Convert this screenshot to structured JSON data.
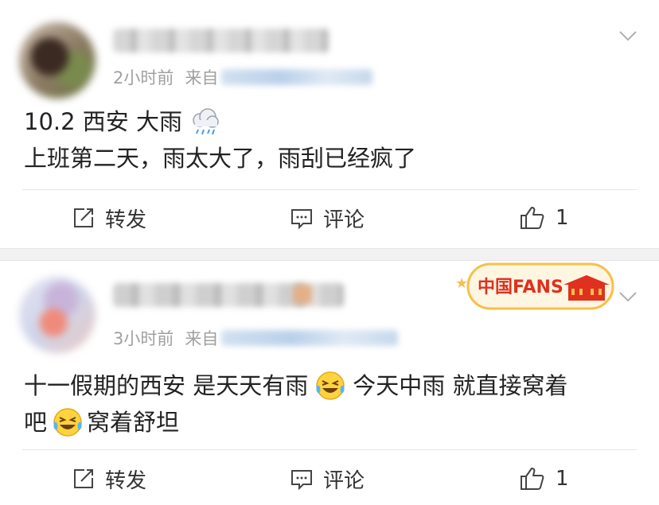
{
  "posts": [
    {
      "time": "2小时前",
      "from_label": "来自",
      "lines": [
        "10.2 西安 大雨",
        "上班第二天，雨太大了，雨刮已经疯了"
      ],
      "emoji": [
        "rain-cloud-icon"
      ],
      "actions": {
        "repost": "转发",
        "comment": "评论",
        "like_count": "1"
      }
    },
    {
      "time": "3小时前",
      "from_label": "来自",
      "lines": [
        "十一假期的西安 是天天有雨",
        "今天中雨  就直接窝着",
        "吧",
        "窝着舒坦"
      ],
      "emoji": [
        "laughing-tears-icon",
        "laughing-tears-icon"
      ],
      "badge_text": "中国FANS",
      "actions": {
        "repost": "转发",
        "comment": "评论",
        "like_count": "1"
      }
    }
  ],
  "colors": {
    "meta": "#a0a0a0",
    "text": "#222222",
    "badge_red": "#e0301e",
    "badge_gold": "#f6c04a",
    "separator": "#f2f2f2"
  }
}
